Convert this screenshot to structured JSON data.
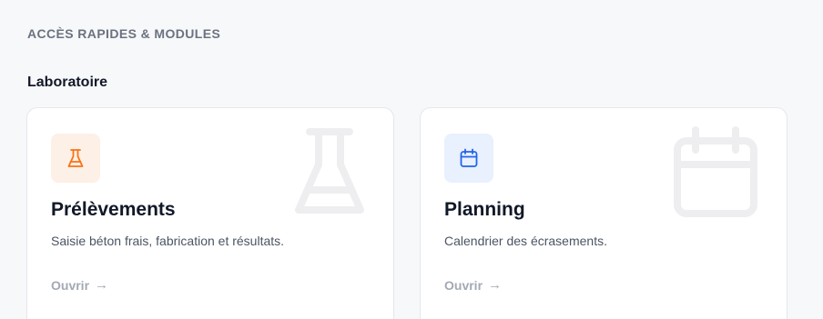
{
  "section": {
    "title": "ACCÈS RAPIDES & MODULES"
  },
  "group": {
    "title": "Laboratoire"
  },
  "cards": [
    {
      "title": "Prélèvements",
      "description": "Saisie béton frais, fabrication et résultats.",
      "link_label": "Ouvrir",
      "icon": "flask-icon",
      "accent": "#f97316",
      "icon_bg": "#fdf0e6"
    },
    {
      "title": "Planning",
      "description": "Calendrier des écrasements.",
      "link_label": "Ouvrir",
      "icon": "calendar-icon",
      "accent": "#2563eb",
      "icon_bg": "#e8f1fd"
    }
  ],
  "arrow_icon": "arrow-right-icon"
}
